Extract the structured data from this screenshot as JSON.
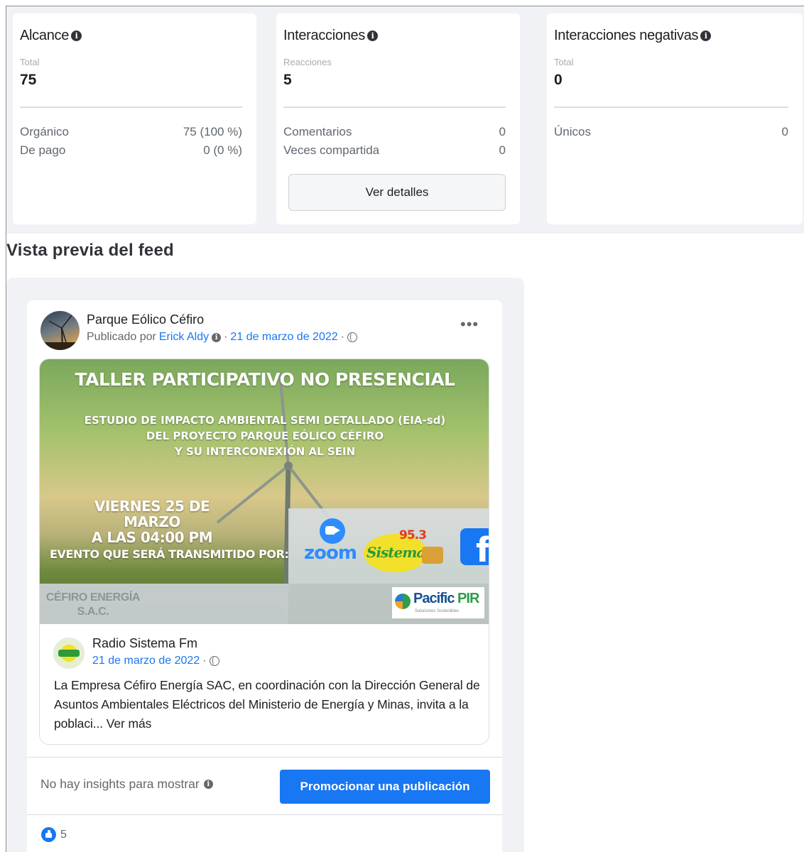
{
  "cards": [
    {
      "title": "Alcance",
      "sub_label": "Total",
      "value": "75",
      "rows": [
        {
          "label": "Orgánico",
          "value": "75 (100 %)"
        },
        {
          "label": "De pago",
          "value": "0 (0 %)"
        }
      ]
    },
    {
      "title": "Interacciones",
      "sub_label": "Reacciones",
      "value": "5",
      "rows": [
        {
          "label": "Comentarios",
          "value": "0"
        },
        {
          "label": "Veces compartida",
          "value": "0"
        }
      ],
      "button_label": "Ver detalles"
    },
    {
      "title": "Interacciones negativas",
      "sub_label": "Total",
      "value": "0",
      "rows": [
        {
          "label": "Únicos",
          "value": "0"
        }
      ]
    }
  ],
  "info_glyph": "i",
  "section_title": "Vista previa del feed",
  "post": {
    "page_name": "Parque Eólico Céfiro",
    "published_by_prefix": "Publicado por",
    "author": "Erick Aldy",
    "separator": "·",
    "date": "21 de marzo de 2022",
    "more_glyph": "•••",
    "banner": {
      "title": "TALLER PARTICIPATIVO NO PRESENCIAL",
      "subtitle_lines": [
        "ESTUDIO DE IMPACTO AMBIENTAL SEMI DETALLADO (EIA-sd)",
        "DEL PROYECTO PARQUE EÓLICO CÉFIRO",
        "Y SU INTERCONEXIÓN AL SEIN"
      ],
      "date_line_1": "VIERNES 25 DE MARZO",
      "date_line_2": "A LAS 04:00 PM",
      "event_line": "EVENTO QUE SERÁ TRANSMITIDO POR:",
      "company_line_1": "CÉFIRO ENERGÍA",
      "company_line_2": "S.A.C.",
      "zoom_label": "zoom",
      "radio_label": "Sistema",
      "radio_freq": "95.3",
      "facebook_glyph": "f",
      "sponsor_name": "Pacific",
      "sponsor_suffix": "PIR",
      "sponsor_tag": "Soluciones Sostenibles"
    },
    "shared": {
      "source_name": "Radio Sistema Fm",
      "date": "21 de marzo de 2022",
      "separator": "·",
      "text": "La Empresa Céfiro Energía SAC, en coordinación con la Dirección General de Asuntos Ambientales Eléctricos del Ministerio de Energía y Minas, invita a la poblaci... Ver más"
    },
    "no_insights": "No hay insights para mostrar",
    "promote_label": "Promocionar una publicación",
    "reactions_count": "5"
  },
  "colors": {
    "accent": "#1877f2",
    "page_bg": "#f0f2f5",
    "text_primary": "#1c1e21",
    "text_secondary": "#65676b"
  },
  "icons": [
    "info-icon",
    "globe-icon",
    "more-icon",
    "like-icon",
    "zoom-icon",
    "facebook-icon"
  ]
}
